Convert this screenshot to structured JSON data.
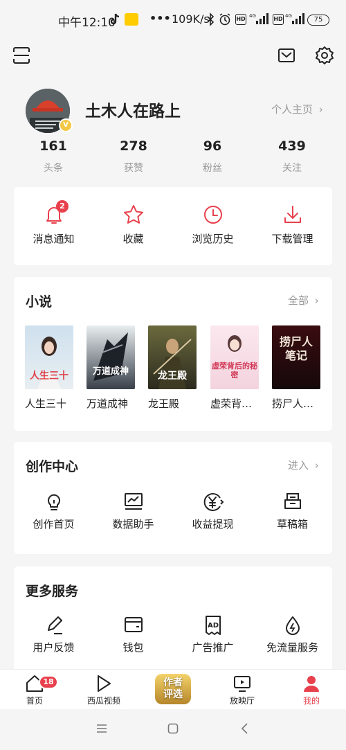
{
  "status_bar": {
    "time": "中午12:10",
    "dots": "•••",
    "speed": "109K/s",
    "battery": "75"
  },
  "profile": {
    "username": "土木人在路上",
    "homepage_link": "个人主页",
    "stats": [
      {
        "value": "161",
        "label": "头条"
      },
      {
        "value": "278",
        "label": "获赞"
      },
      {
        "value": "96",
        "label": "粉丝"
      },
      {
        "value": "439",
        "label": "关注"
      }
    ]
  },
  "quick_actions": [
    {
      "label": "消息通知",
      "icon": "bell-icon",
      "badge": "2"
    },
    {
      "label": "收藏",
      "icon": "star-icon"
    },
    {
      "label": "浏览历史",
      "icon": "clock-icon"
    },
    {
      "label": "下载管理",
      "icon": "download-icon"
    }
  ],
  "novels": {
    "title": "小说",
    "link": "全部",
    "books": [
      {
        "name": "人生三十",
        "cover_text": "人生三十"
      },
      {
        "name": "万道成神",
        "cover_text": "万道成神"
      },
      {
        "name": "龙王殿",
        "cover_text": "龙王殿"
      },
      {
        "name": "虚荣背…",
        "cover_text": "虚荣背后的秘密"
      },
      {
        "name": "捞尸人…",
        "cover_text": "捞尸人笔记"
      }
    ]
  },
  "creation": {
    "title": "创作中心",
    "link": "进入",
    "items": [
      {
        "label": "创作首页",
        "icon": "bulb-icon"
      },
      {
        "label": "数据助手",
        "icon": "chart-icon"
      },
      {
        "label": "收益提现",
        "icon": "yuan-icon"
      },
      {
        "label": "草稿箱",
        "icon": "draft-box-icon"
      }
    ]
  },
  "more_services": {
    "title": "更多服务",
    "items": [
      {
        "label": "用户反馈",
        "icon": "pen-icon"
      },
      {
        "label": "钱包",
        "icon": "wallet-icon"
      },
      {
        "label": "广告推广",
        "icon": "ad-icon"
      },
      {
        "label": "免流量服务",
        "icon": "data-drop-icon"
      }
    ]
  },
  "bottom_nav": {
    "items": [
      {
        "label": "首页",
        "badge": "18"
      },
      {
        "label": "西瓜视频"
      },
      {
        "label": "作者评选"
      },
      {
        "label": "放映厅"
      },
      {
        "label": "我的"
      }
    ]
  },
  "colors": {
    "accent": "#e8414d",
    "text": "#222222",
    "muted": "#999999"
  }
}
